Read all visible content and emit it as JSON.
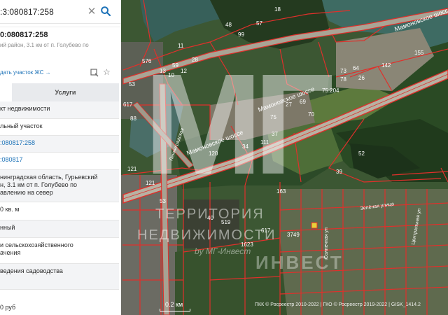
{
  "search": {
    "value": ":3:080817:258",
    "clear_icon": "close-icon",
    "search_icon": "magnifier-icon"
  },
  "result": {
    "title": "0:080817:258",
    "subtitle": "ий район, 3.1 км от п. Голубево по",
    "action_link": "дать участок ЖС →",
    "icons": [
      "map-pin-icon",
      "star-icon"
    ]
  },
  "tabs": {
    "info": "",
    "services": "Услуги"
  },
  "details": [
    "кт недвижимости",
    "льный участок",
    ":080817:258",
    ":080817",
    "нинградская область, Гурьевский\nн, 3.1 км от п. Голубево по\nавлению на север",
    "0 кв. м",
    "нный",
    "и сельскохозяйственного\nачения",
    "ведения садоводства",
    "0 руб"
  ],
  "map": {
    "roads": [
      "Мамоновское шоссе",
      "Мамоновское шоссе",
      "Мамоновское шоссе"
    ],
    "plot_numbers": [
      "18",
      "48",
      "99",
      "57",
      "11",
      "576",
      "59",
      "12",
      "10",
      "28",
      "13",
      "53",
      "155",
      "142",
      "64",
      "73",
      "26",
      "78",
      "75:204",
      "27",
      "69",
      "70",
      "75",
      "37",
      "34",
      "111",
      "121",
      "120",
      "617",
      "88",
      "52",
      "163",
      "121",
      "53",
      "40",
      "1623",
      "3749",
      "617",
      "519",
      "39"
    ],
    "streets": [
      "Ленинградская",
      "Центральная ул",
      "Зелёная улица",
      "Солнечная ул"
    ],
    "watermark_letters": "МГ",
    "watermark_line1": "ТЕРРИТОРИЯ",
    "watermark_line2": "НЕДВИЖИМОСТИ",
    "watermark_line3": "by МГ-Инвест",
    "watermark_line4": "ИНВЕСТ",
    "scale_label": "0.2 км",
    "copyright": "ПКК © Росреестр 2010-2022 | ГКО © Росреестр 2019-2022 | GISK_1414.2"
  },
  "colors": {
    "link": "#1e73b8",
    "parcel_border": "#e0302b",
    "search_button": "#1e73b8"
  }
}
